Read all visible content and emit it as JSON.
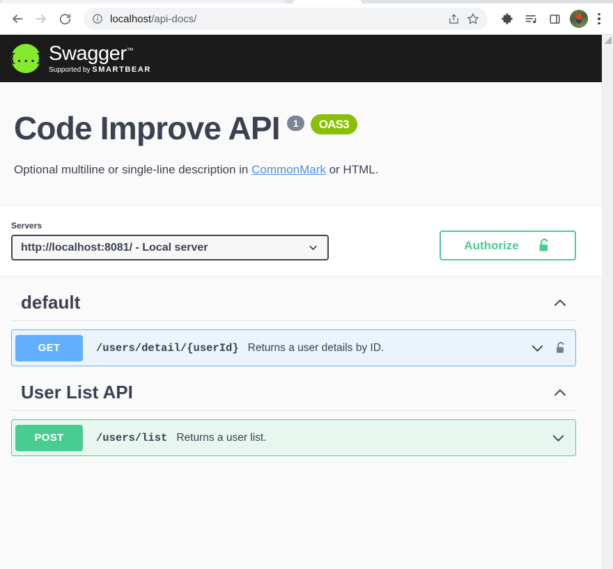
{
  "browser": {
    "nav": {
      "back": "back-arrow",
      "forward": "forward-arrow",
      "reload": "reload"
    },
    "url": {
      "host": "localhost",
      "path": "/api-docs/",
      "site_info_icon": "info-circle"
    },
    "omnibox_actions": [
      "share-icon",
      "bookmark-star-icon"
    ],
    "toolbar_icons": [
      "extensions-puzzle-icon",
      "media-playlist-icon",
      "side-panel-icon",
      "profile-avatar",
      "kebab-menu-icon"
    ]
  },
  "swagger": {
    "logo": {
      "glyph": "{...}",
      "brand": "Swagger",
      "trademark": "™",
      "supported_prefix": "Supported by",
      "supported_brand": "SMARTBEAR"
    },
    "info": {
      "title": "Code Improve API",
      "version_badge": "1",
      "spec_badge": "OAS3",
      "description_before": "Optional multiline or single-line description in ",
      "description_link": "CommonMark",
      "description_after": " or HTML."
    },
    "servers": {
      "label": "Servers",
      "selected": "http://localhost:8081/ - Local server",
      "options": [
        "http://localhost:8081/ - Local server"
      ],
      "chevron_icon": "chevron-down-icon"
    },
    "authorize": {
      "label": "Authorize",
      "lock_icon": "unlocked-padlock-icon",
      "color": "#49cc90"
    },
    "tags": [
      {
        "name": "default",
        "expanded": true,
        "toggle_icon": "chevron-up-icon",
        "operations": [
          {
            "method": "GET",
            "path": "/users/detail/{userId}",
            "summary": "Returns a user details by ID.",
            "expand_icon": "chevron-down-icon",
            "auth_icon": "unlocked-padlock-icon",
            "has_auth": true,
            "accent": "#61affe"
          }
        ]
      },
      {
        "name": "User List API",
        "expanded": true,
        "toggle_icon": "chevron-up-icon",
        "operations": [
          {
            "method": "POST",
            "path": "/users/list",
            "summary": "Returns a user list.",
            "expand_icon": "chevron-down-icon",
            "auth_icon": "",
            "has_auth": false,
            "accent": "#49cc90"
          }
        ]
      }
    ]
  }
}
